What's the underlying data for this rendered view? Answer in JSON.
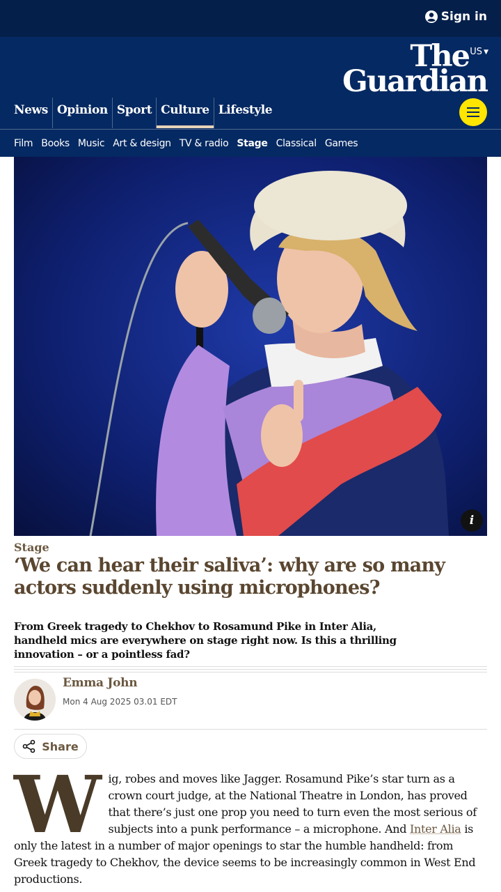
{
  "header": {
    "sign_in": "Sign in",
    "edition": "US",
    "logo_line1": "The",
    "logo_line2": "Guardian"
  },
  "pillars": [
    {
      "label": "News"
    },
    {
      "label": "Opinion"
    },
    {
      "label": "Sport"
    },
    {
      "label": "Culture",
      "active": true
    },
    {
      "label": "Lifestyle"
    }
  ],
  "subnav": [
    {
      "label": "Film"
    },
    {
      "label": "Books"
    },
    {
      "label": "Music"
    },
    {
      "label": "Art & design"
    },
    {
      "label": "TV & radio"
    },
    {
      "label": "Stage",
      "active": true
    },
    {
      "label": "Classical"
    },
    {
      "label": "Games"
    }
  ],
  "article": {
    "kicker": "Stage",
    "headline": "‘We can hear their saliva’: why are so many actors suddenly using microphones?",
    "standfirst": "From Greek tragedy to Chekhov to Rosamund Pike in Inter Alia, handheld mics are everywhere on stage right now. Is this a thrilling innovation – or a pointless fad?",
    "author": "Emma John",
    "date": "Mon 4 Aug 2025 03.01 EDT",
    "share_label": "Share",
    "image_info": "i",
    "dropcap": "W",
    "body_part1": "ig, robes and moves like Jagger. Rosamund Pike’s star turn as a crown court judge, at the National Theatre in London, has proved that there’s just one prop you need to turn even the most serious of subjects into a punk performance – a microphone. And ",
    "body_link": "Inter Alia",
    "body_part2": " is only the latest in a number of major openings to star the humble handheld: from Greek tragedy to Chekhov, the device seems to be increasingly common in West End productions."
  },
  "colors": {
    "brand_dark": "#041f4a",
    "brand": "#052962",
    "menu_button": "#ffe500",
    "culture_accent": "#6b5840",
    "culture_headline": "#5a4630"
  },
  "icons": [
    "user-icon",
    "chevron-down-icon",
    "hamburger-icon",
    "info-icon",
    "share-icon"
  ]
}
